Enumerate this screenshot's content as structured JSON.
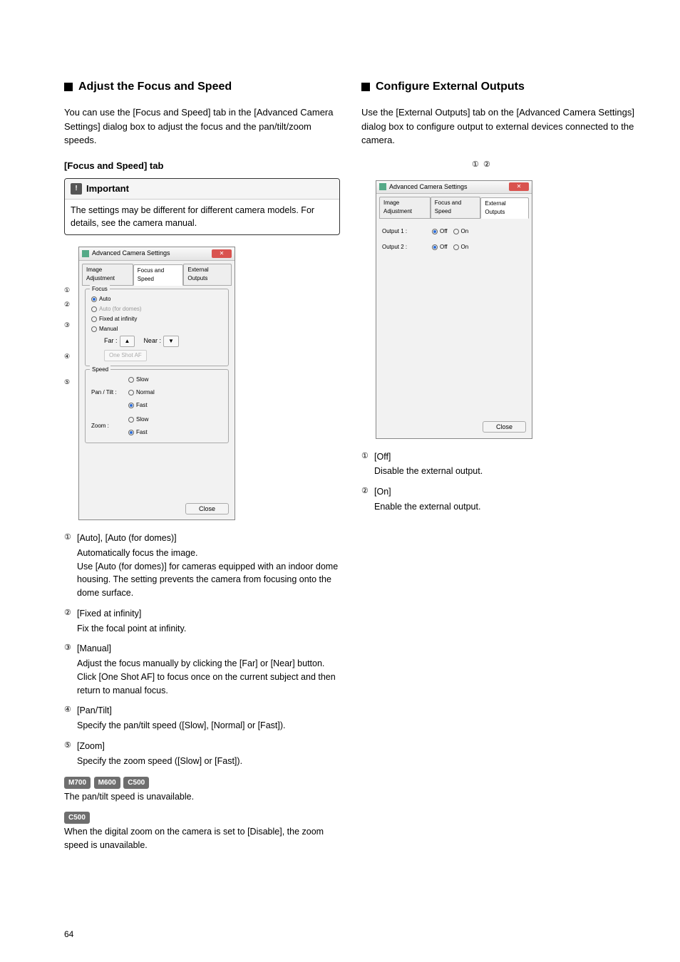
{
  "page_number": "64",
  "left": {
    "heading": "Adjust the Focus and Speed",
    "intro": "You can use the [Focus and Speed] tab in the [Advanced Camera Settings] dialog box to adjust the focus and the pan/tilt/zoom speeds.",
    "tab_heading": "[Focus and Speed] tab",
    "important_label": "Important",
    "important_text": "The settings may be different for different camera models. For details, see the camera manual.",
    "dialog": {
      "title": "Advanced Camera Settings",
      "tabs": [
        "Image Adjustment",
        "Focus and Speed",
        "External Outputs"
      ],
      "focus_legend": "Focus",
      "focus_options": {
        "auto": "Auto",
        "auto_domes": "Auto (for domes)",
        "fixed": "Fixed at infinity",
        "manual": "Manual"
      },
      "far_label": "Far :",
      "near_label": "Near :",
      "one_shot": "One Shot AF",
      "speed_legend": "Speed",
      "pantilt_label": "Pan / Tilt :",
      "zoom_label": "Zoom :",
      "speed_opts": {
        "slow": "Slow",
        "normal": "Normal",
        "fast": "Fast"
      },
      "close": "Close"
    },
    "items": [
      {
        "mark": "①",
        "label": "[Auto], [Auto (for domes)]",
        "desc": "Automatically focus the image.\nUse [Auto (for domes)] for cameras equipped with an indoor dome housing. The setting prevents the camera from focusing onto the dome surface."
      },
      {
        "mark": "②",
        "label": "[Fixed at infinity]",
        "desc": "Fix the focal point at infinity."
      },
      {
        "mark": "③",
        "label": "[Manual]",
        "desc": "Adjust the focus manually by clicking the [Far] or [Near] button.\nClick [One Shot AF] to focus once on the current subject and then return to manual focus."
      },
      {
        "mark": "④",
        "label": "[Pan/Tilt]",
        "desc": "Specify the pan/tilt speed ([Slow], [Normal] or [Fast])."
      },
      {
        "mark": "⑤",
        "label": "[Zoom]",
        "desc": "Specify the zoom speed ([Slow] or [Fast])."
      }
    ],
    "model_line1_badges": [
      "M700",
      "M600",
      "C500"
    ],
    "model_line1_text": "The pan/tilt speed is unavailable.",
    "model_line2_badges": [
      "C500"
    ],
    "model_line2_text": "When the digital zoom on the camera is set to [Disable], the zoom speed is unavailable."
  },
  "right": {
    "heading": "Configure External Outputs",
    "intro": "Use the [External Outputs] tab on the [Advanced Camera Settings] dialog box to configure output to external devices connected to the camera.",
    "top_markers": {
      "m1": "①",
      "m2": "②"
    },
    "dialog": {
      "title": "Advanced Camera Settings",
      "tabs": [
        "Image Adjustment",
        "Focus and Speed",
        "External Outputs"
      ],
      "output1": "Output 1 :",
      "output2": "Output 2 :",
      "off": "Off",
      "on": "On",
      "close": "Close"
    },
    "items": [
      {
        "mark": "①",
        "label": "[Off]",
        "desc": "Disable the external output."
      },
      {
        "mark": "②",
        "label": "[On]",
        "desc": "Enable the external output."
      }
    ]
  }
}
